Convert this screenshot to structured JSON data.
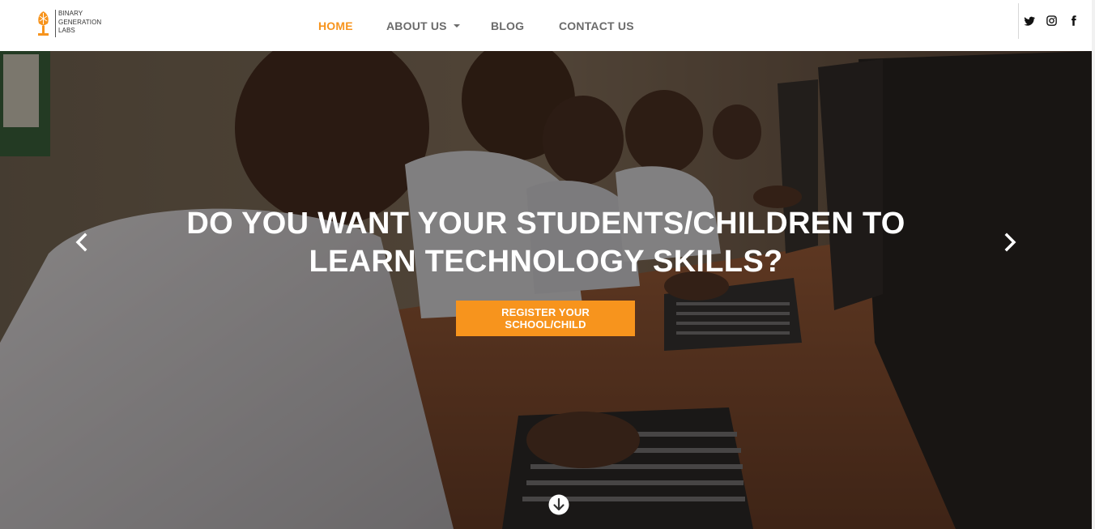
{
  "brand": {
    "lines": [
      "BINARY",
      "GENERATION",
      "LABS"
    ],
    "accent": "#f7941d"
  },
  "nav": {
    "home": "HOME",
    "about": "ABOUT US",
    "blog": "BLOG",
    "contact": "CONTACT US",
    "active": "HOME"
  },
  "social": [
    "twitter-icon",
    "instagram-icon",
    "facebook-icon"
  ],
  "hero": {
    "title_line1": "DO YOU WANT YOUR STUDENTS/CHILDREN TO",
    "title_line2": "LEARN TECHNOLOGY SKILLS?",
    "cta": "REGISTER YOUR SCHOOL/CHILD",
    "prev_icon": "chevron-left-icon",
    "next_icon": "chevron-right-icon",
    "scroll_icon": "arrow-down-circle-icon"
  },
  "colors": {
    "accent": "#f7941d",
    "nav_text": "#6b6b6b",
    "hero_text": "#ffffff"
  }
}
